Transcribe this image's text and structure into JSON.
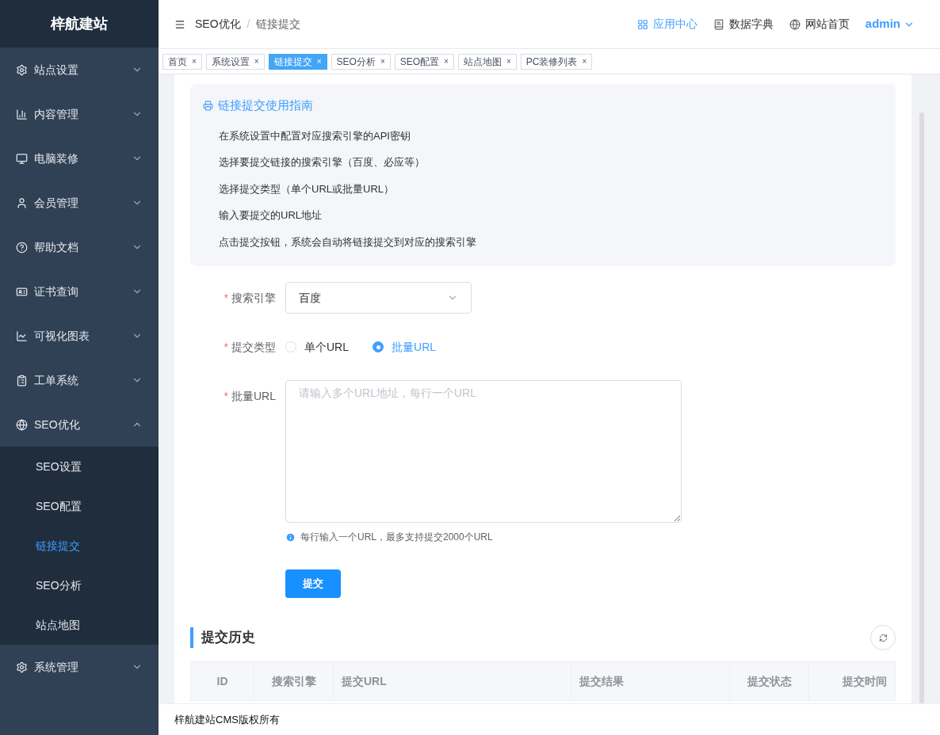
{
  "sidebar": {
    "logo": "梓航建站",
    "items": [
      {
        "label": "站点设置",
        "expanded": false
      },
      {
        "label": "内容管理",
        "expanded": false
      },
      {
        "label": "电脑装修",
        "expanded": false
      },
      {
        "label": "会员管理",
        "expanded": false
      },
      {
        "label": "帮助文档",
        "expanded": false
      },
      {
        "label": "证书查询",
        "expanded": false
      },
      {
        "label": "可视化图表",
        "expanded": false
      },
      {
        "label": "工单系统",
        "expanded": false
      },
      {
        "label": "SEO优化",
        "expanded": true,
        "children": [
          {
            "label": "SEO设置",
            "selected": false
          },
          {
            "label": "SEO配置",
            "selected": false
          },
          {
            "label": "链接提交",
            "selected": true
          },
          {
            "label": "SEO分析",
            "selected": false
          },
          {
            "label": "站点地图",
            "selected": false
          }
        ]
      },
      {
        "label": "系统管理",
        "expanded": false
      }
    ]
  },
  "header": {
    "breadcrumb": [
      "SEO优化",
      "链接提交"
    ],
    "separator": "/",
    "links": [
      {
        "label": "应用中心",
        "selected": true
      },
      {
        "label": "数据字典",
        "selected": false
      },
      {
        "label": "网站首页",
        "selected": false
      }
    ],
    "user": "admin"
  },
  "tabs": [
    {
      "label": "首页",
      "selected": false
    },
    {
      "label": "系统设置",
      "selected": false
    },
    {
      "label": "链接提交",
      "selected": true
    },
    {
      "label": "SEO分析",
      "selected": false
    },
    {
      "label": "SEO配置",
      "selected": false
    },
    {
      "label": "站点地图",
      "selected": false
    },
    {
      "label": "PC装修列表",
      "selected": false
    }
  ],
  "close_glyph": "×",
  "guide": {
    "title": "链接提交使用指南",
    "steps": [
      "在系统设置中配置对应搜索引擎的API密钥",
      "选择要提交链接的搜索引擎（百度、必应等）",
      "选择提交类型（单个URL或批量URL）",
      "输入要提交的URL地址",
      "点击提交按钮，系统会自动将链接提交到对应的搜索引擎"
    ]
  },
  "form": {
    "required_mark": "*",
    "engine": {
      "label": "搜索引擎",
      "value": "百度"
    },
    "type": {
      "label": "提交类型",
      "options": [
        {
          "label": "单个URL",
          "selected": false
        },
        {
          "label": "批量URL",
          "selected": true
        }
      ]
    },
    "urls": {
      "label": "批量URL",
      "placeholder": "请输入多个URL地址，每行一个URL",
      "hint": "每行输入一个URL，最多支持提交2000个URL"
    },
    "submit": "提交"
  },
  "history": {
    "title": "提交历史",
    "columns": [
      "ID",
      "搜索引擎",
      "提交URL",
      "提交结果",
      "提交状态",
      "提交时间"
    ]
  },
  "footer": "梓航建站CMS版权所有"
}
